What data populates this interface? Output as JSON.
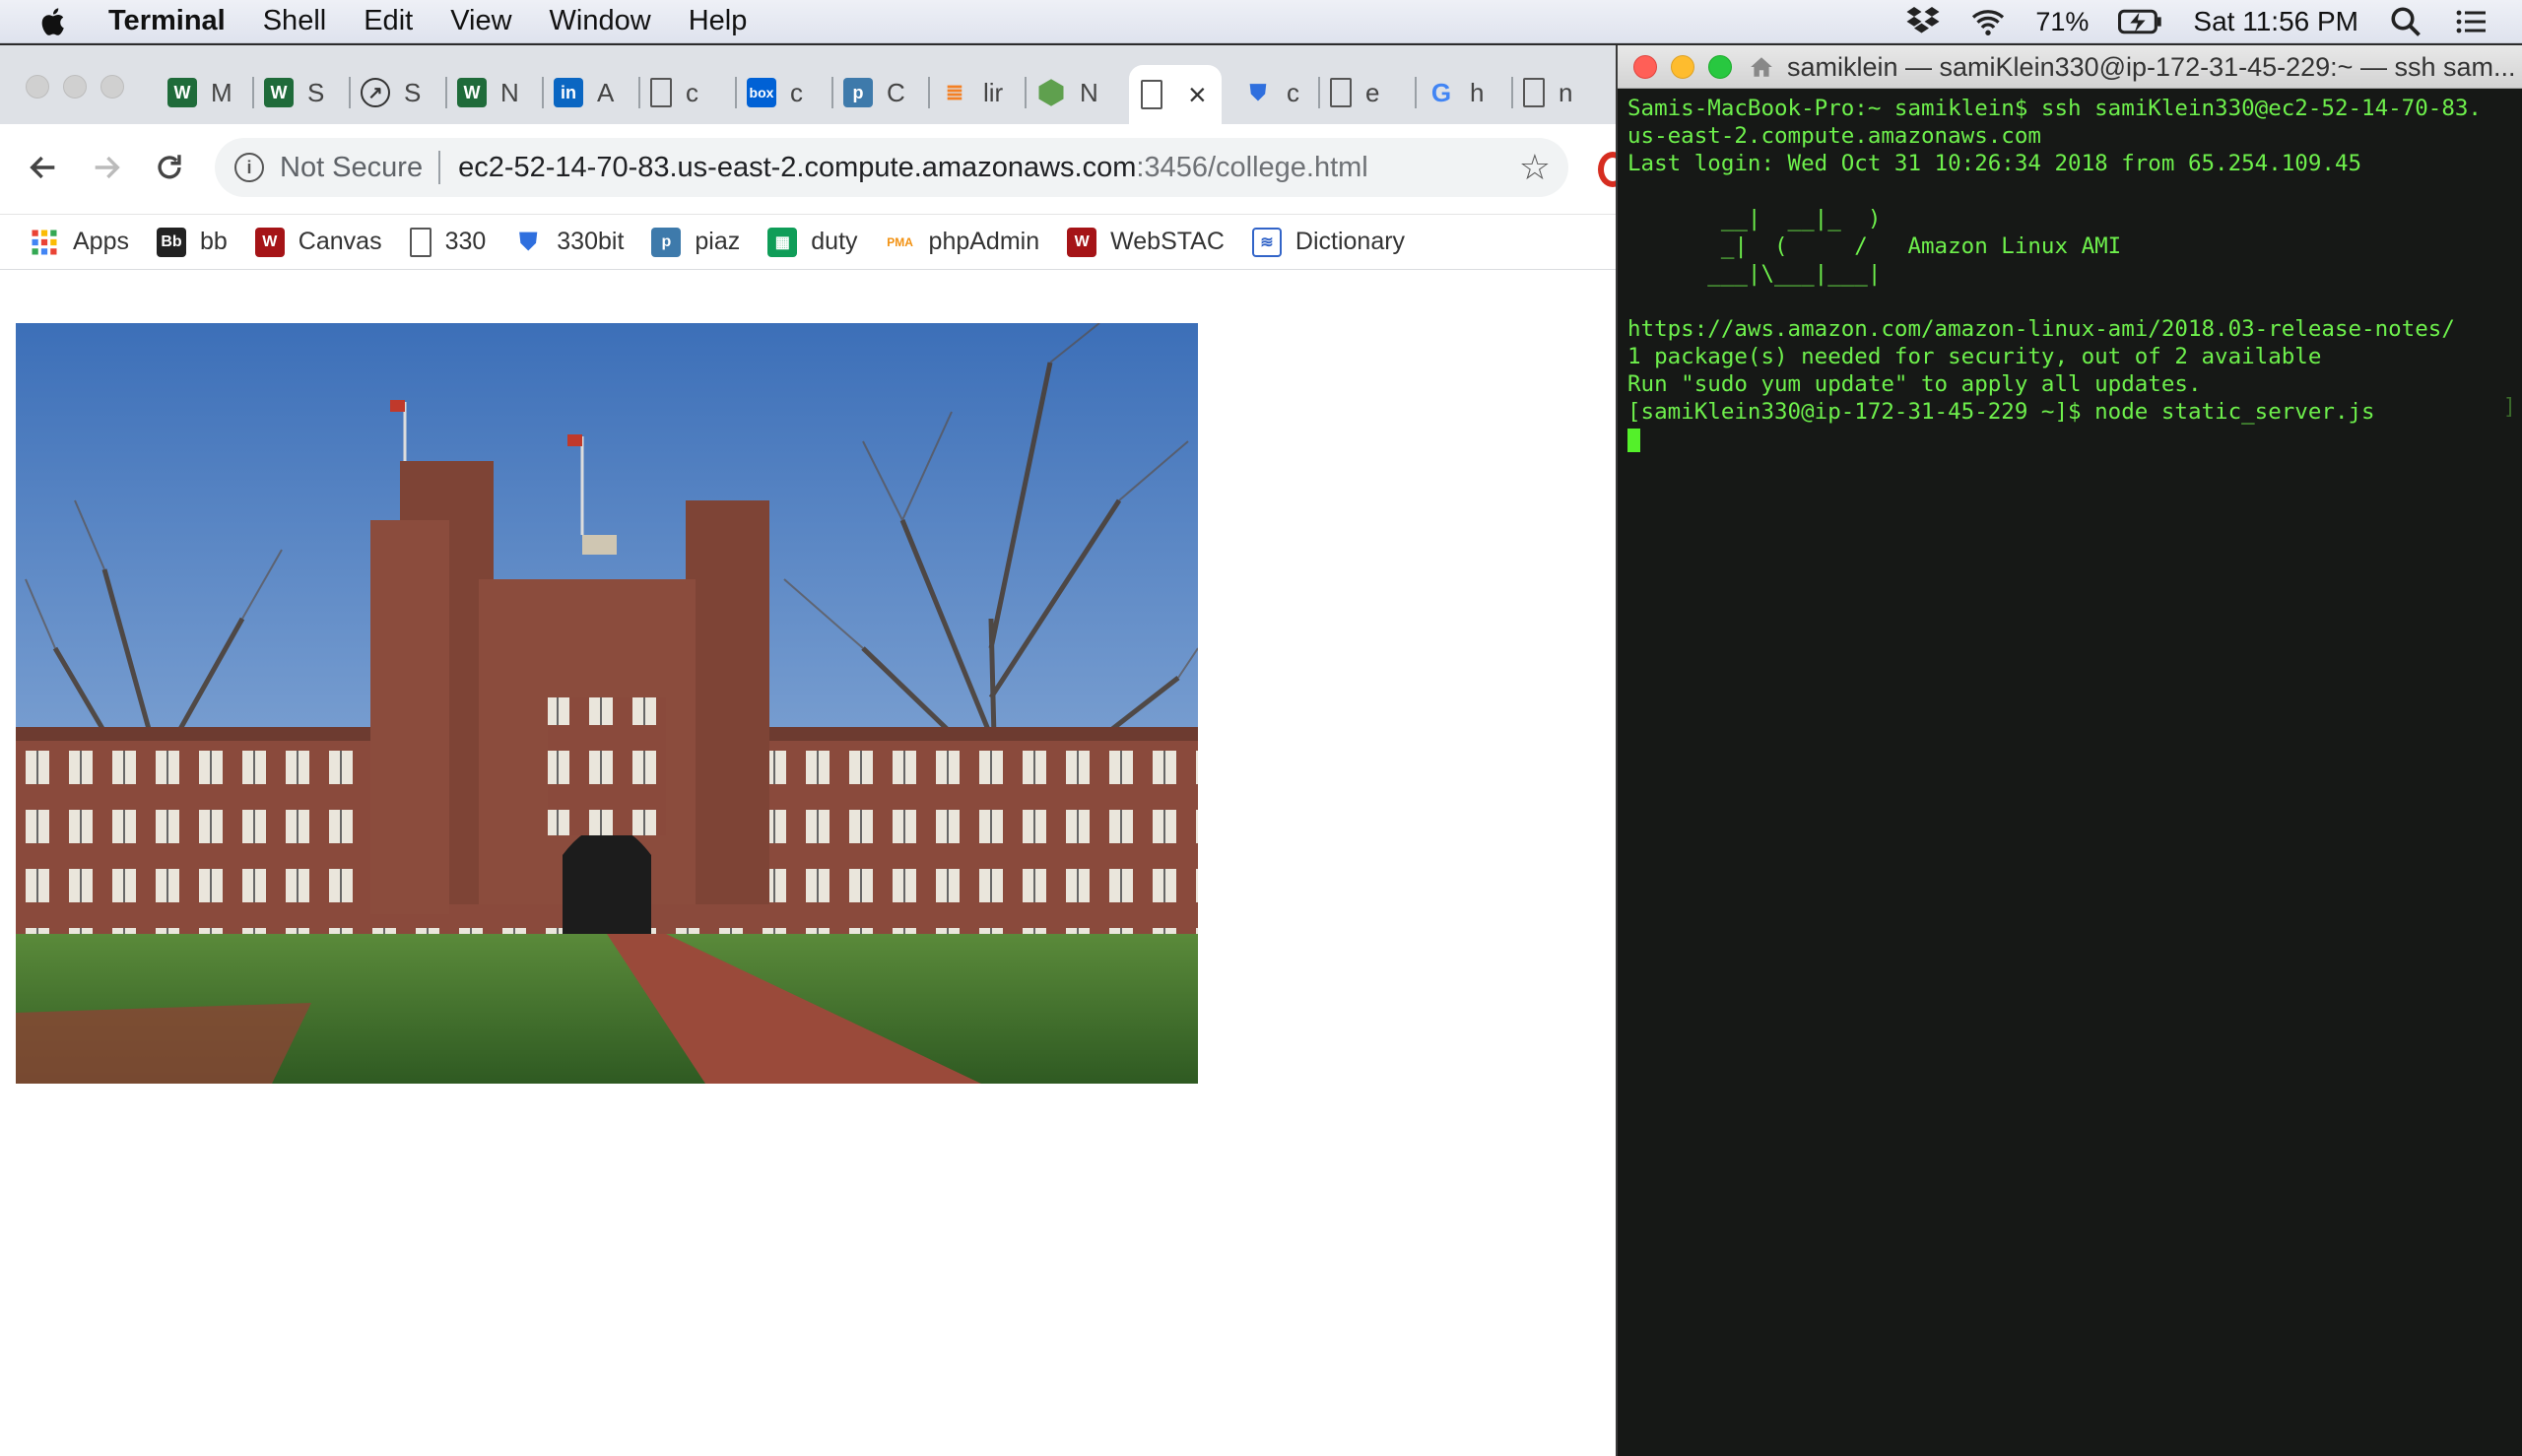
{
  "menubar": {
    "app": "Terminal",
    "menus": [
      "Shell",
      "Edit",
      "View",
      "Window",
      "Help"
    ],
    "battery": "71%",
    "clock": "Sat 11:56 PM"
  },
  "browser": {
    "tabs": [
      {
        "label": "M",
        "icon": "wustl-shield-icon"
      },
      {
        "label": "S",
        "icon": "wustl-shield-icon"
      },
      {
        "label": "S",
        "icon": "compass-icon"
      },
      {
        "label": "N",
        "icon": "wustl-shield-icon"
      },
      {
        "label": "A",
        "icon": "linkedin-icon"
      },
      {
        "label": "c",
        "icon": "document-icon"
      },
      {
        "label": "c",
        "icon": "box-icon"
      },
      {
        "label": "C",
        "icon": "piazza-icon"
      },
      {
        "label": "lir",
        "icon": "stackoverflow-icon"
      },
      {
        "label": "N",
        "icon": "nodejs-icon"
      },
      {
        "label": "",
        "icon": "document-icon",
        "active": true
      },
      {
        "label": "c",
        "icon": "blue-shield-icon"
      },
      {
        "label": "e",
        "icon": "document-icon"
      },
      {
        "label": "h",
        "icon": "google-icon"
      },
      {
        "label": "n",
        "icon": "document-icon"
      }
    ],
    "security_label": "Not Secure",
    "url_host": "ec2-52-14-70-83.us-east-2.compute.amazonaws.com",
    "url_path": ":3456/college.html",
    "bookmarks": [
      {
        "label": "Apps",
        "icon": "apps-grid-icon"
      },
      {
        "label": "bb",
        "icon": "blackboard-icon"
      },
      {
        "label": "Canvas",
        "icon": "wustl-crest-icon"
      },
      {
        "label": "330",
        "icon": "document-icon"
      },
      {
        "label": "330bit",
        "icon": "blue-shield-icon"
      },
      {
        "label": "piaz",
        "icon": "piazza-icon"
      },
      {
        "label": "duty",
        "icon": "sheets-icon"
      },
      {
        "label": "phpAdmin",
        "icon": "phpmyadmin-icon"
      },
      {
        "label": "WebSTAC",
        "icon": "wustl-crest-icon"
      },
      {
        "label": "Dictionary",
        "icon": "dictionary-icon"
      }
    ]
  },
  "terminal": {
    "title": "samiklein — samiKlein330@ip-172-31-45-229:~ — ssh sam...",
    "lines": [
      "Samis-MacBook-Pro:~ samiklein$ ssh samiKlein330@ec2-52-14-70-83.",
      "us-east-2.compute.amazonaws.com",
      "Last login: Wed Oct 31 10:26:34 2018 from 65.254.109.45",
      "",
      "       __|  __|_  )",
      "       _|  (     /   Amazon Linux AMI",
      "      ___|\\___|___|",
      "",
      "https://aws.amazon.com/amazon-linux-ami/2018.03-release-notes/",
      "1 package(s) needed for security, out of 2 available",
      "Run \"sudo yum update\" to apply all updates.",
      "[samiKlein330@ip-172-31-45-229 ~]$ node static_server.js"
    ]
  },
  "colors": {
    "terminal_text": "#6ef04c",
    "terminal_bg": "#161816",
    "close_red": "#ff5f57",
    "minimize_yellow": "#febc2e",
    "zoom_green": "#28c840"
  }
}
